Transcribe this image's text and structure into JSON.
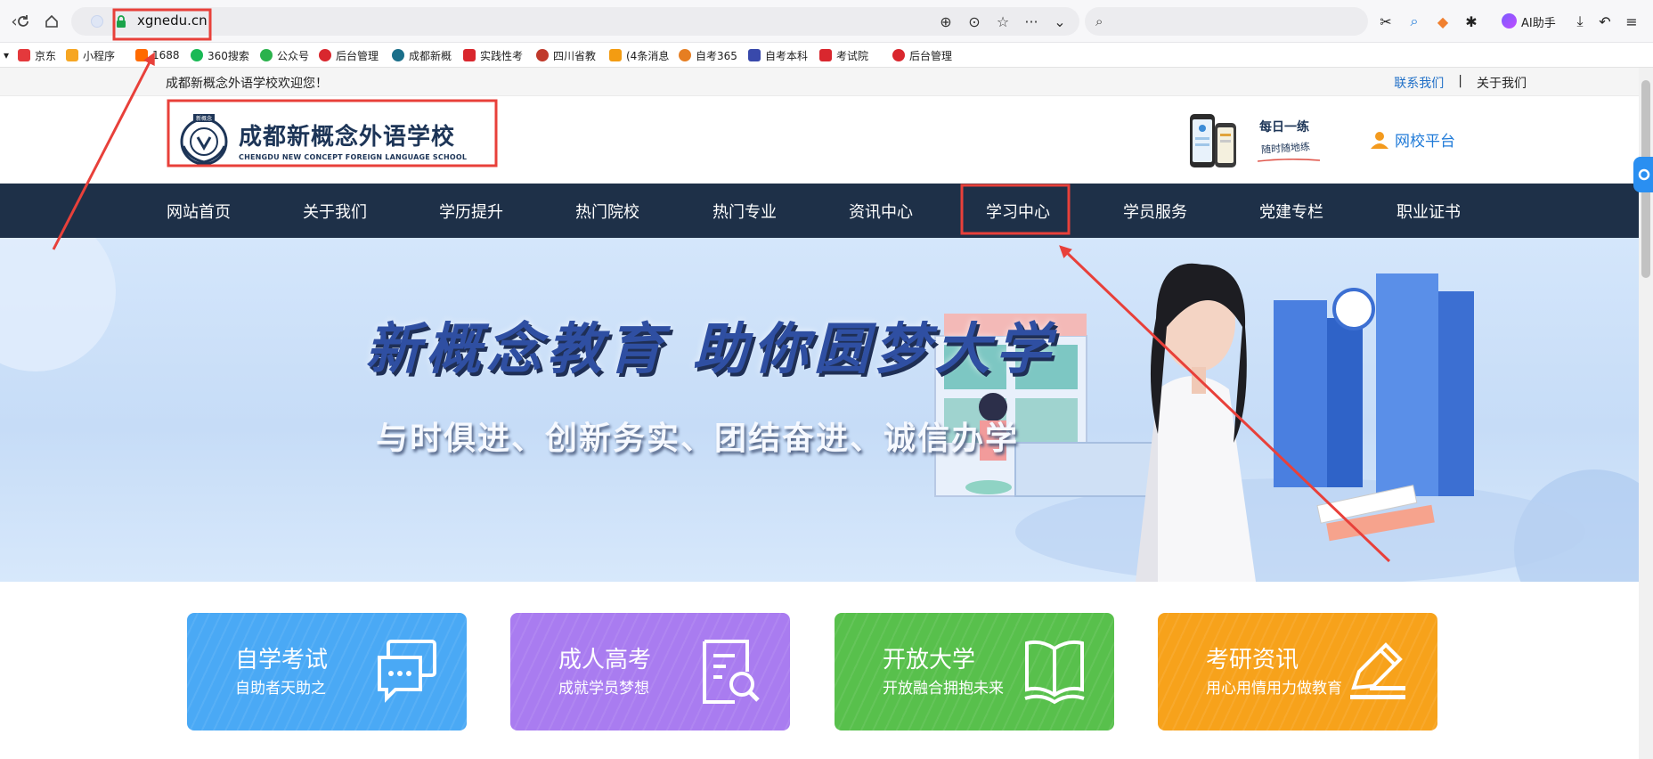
{
  "browser": {
    "url": "xgnedu.cn",
    "ai_label": "AI助手",
    "bookmarks": [
      {
        "label": "京东",
        "color": "#e4393c"
      },
      {
        "label": "小程序",
        "color": "#f6a623"
      },
      {
        "label": "1688",
        "color": "#ff6a00"
      },
      {
        "label": "360搜索",
        "color": "#19b955"
      },
      {
        "label": "公众号",
        "color": "#2bb24c"
      },
      {
        "label": "后台管理",
        "color": "#d9272e"
      },
      {
        "label": "成都新概",
        "color": "#1b6f8a"
      },
      {
        "label": "实践性考",
        "color": "#d9272e"
      },
      {
        "label": "四川省教",
        "color": "#c0392b"
      },
      {
        "label": "(4条消息",
        "color": "#f39c12"
      },
      {
        "label": "自考365",
        "color": "#e67e22"
      },
      {
        "label": "自考本科",
        "color": "#3949ab"
      },
      {
        "label": "考试院",
        "color": "#d9272e"
      },
      {
        "label": "后台管理",
        "color": "#d9272e"
      }
    ]
  },
  "site": {
    "welcome": "成都新概念外语学校欢迎您！",
    "contact": "联系我们",
    "separator": "|",
    "about_link": "关于我们",
    "logo_badge": "新概念",
    "logo_cn": "成都新概念外语学校",
    "logo_en": "CHENGDU NEW CONCEPT FOREIGN LANGUAGE SCHOOL",
    "daily": "每日一练",
    "daily_sub": "随时随地练",
    "platform": "网校平台"
  },
  "nav": [
    "网站首页",
    "关于我们",
    "学历提升",
    "热门院校",
    "热门专业",
    "资讯中心",
    "学习中心",
    "学员服务",
    "党建专栏",
    "职业证书"
  ],
  "banner": {
    "title": "新概念教育  助你圆梦大学",
    "subtitle": "与时俱进、创新务实、团结奋进、诚信办学"
  },
  "cards": [
    {
      "title": "自学考试",
      "sub": "自助者天助之",
      "color": "#4aa9f5",
      "icon": "chat-icon"
    },
    {
      "title": "成人高考",
      "sub": "成就学员梦想",
      "color": "#a97cf0",
      "icon": "search-doc-icon"
    },
    {
      "title": "开放大学",
      "sub": "开放融合拥抱未来",
      "color": "#58c04c",
      "icon": "book-icon"
    },
    {
      "title": "考研资讯",
      "sub": "用心用情用力做教育",
      "color": "#f7a21b",
      "icon": "pen-icon"
    }
  ],
  "colors": {
    "nav_bg": "#1e3048",
    "annotation": "#e8403a"
  }
}
